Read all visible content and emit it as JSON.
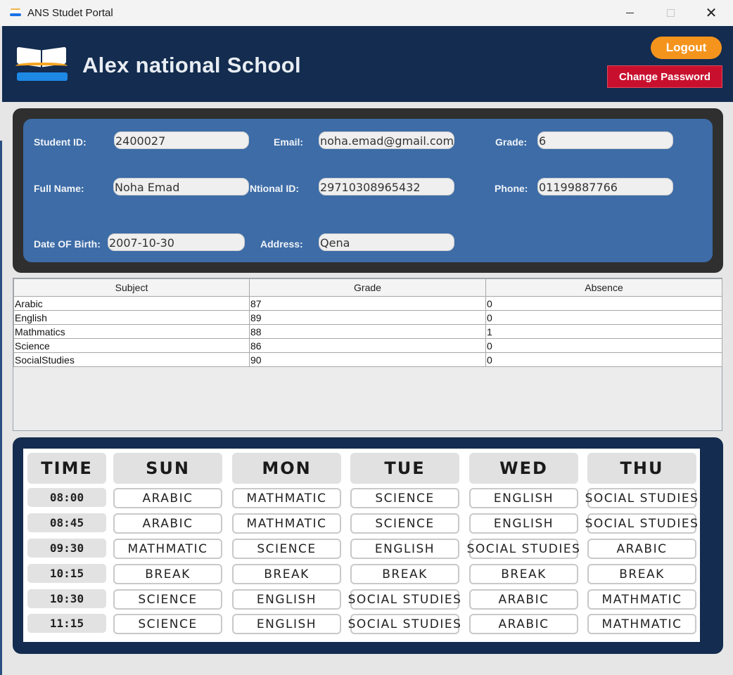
{
  "window": {
    "title": "ANS Studet Portal"
  },
  "header": {
    "school_name": "Alex national School",
    "logout_label": "Logout",
    "change_password_label": "Change Password"
  },
  "student": {
    "student_id_label": "Student ID:",
    "student_id": "2400027",
    "email_label": "Email:",
    "email": "noha.emad@gmail.com",
    "grade_label": "Grade:",
    "grade": "6",
    "full_name_label": "Full Name:",
    "full_name": "Noha Emad",
    "national_id_label": "Ntional ID:",
    "national_id": "29710308965432",
    "phone_label": "Phone:",
    "phone": "01199887766",
    "dob_label": "Date OF Birth:",
    "dob": "2007-10-30",
    "address_label": "Address:",
    "address": "Qena"
  },
  "grades_table": {
    "columns": [
      "Subject",
      "Grade",
      "Absence"
    ],
    "rows": [
      [
        "Arabic",
        "87",
        "0"
      ],
      [
        "English",
        "89",
        "0"
      ],
      [
        "Mathmatics",
        "88",
        "1"
      ],
      [
        "Science",
        "86",
        "0"
      ],
      [
        "SocialStudies",
        "90",
        "0"
      ]
    ]
  },
  "timetable": {
    "headers": [
      "TIME",
      "SUN",
      "MON",
      "TUE",
      "WED",
      "THU"
    ],
    "rows": [
      {
        "time": "08:00",
        "subjects": [
          "ARABIC",
          "MATHMATIC",
          "SCIENCE",
          "ENGLISH",
          "SOCIAL STUDIES"
        ]
      },
      {
        "time": "08:45",
        "subjects": [
          "ARABIC",
          "MATHMATIC",
          "SCIENCE",
          "ENGLISH",
          "SOCIAL STUDIES"
        ]
      },
      {
        "time": "09:30",
        "subjects": [
          "MATHMATIC",
          "SCIENCE",
          "ENGLISH",
          "SOCIAL STUDIES",
          "ARABIC"
        ]
      },
      {
        "time": "10:15",
        "subjects": [
          "BREAK",
          "BREAK",
          "BREAK",
          "BREAK",
          "BREAK"
        ]
      },
      {
        "time": "10:30",
        "subjects": [
          "SCIENCE",
          "ENGLISH",
          "SOCIAL STUDIES",
          "ARABIC",
          "MATHMATIC"
        ]
      },
      {
        "time": "11:15",
        "subjects": [
          "SCIENCE",
          "ENGLISH",
          "SOCIAL STUDIES",
          "ARABIC",
          "MATHMATIC"
        ]
      }
    ]
  },
  "icons": {
    "app": "book-icon",
    "minimize": "minimize-icon",
    "maximize": "maximize-icon",
    "close": "close-icon",
    "logo": "open-book-logo-icon"
  },
  "colors": {
    "header_bg": "#132c4f",
    "info_bg": "#3d6ca7",
    "logout": "#f5941d",
    "change_password": "#c8102e"
  }
}
